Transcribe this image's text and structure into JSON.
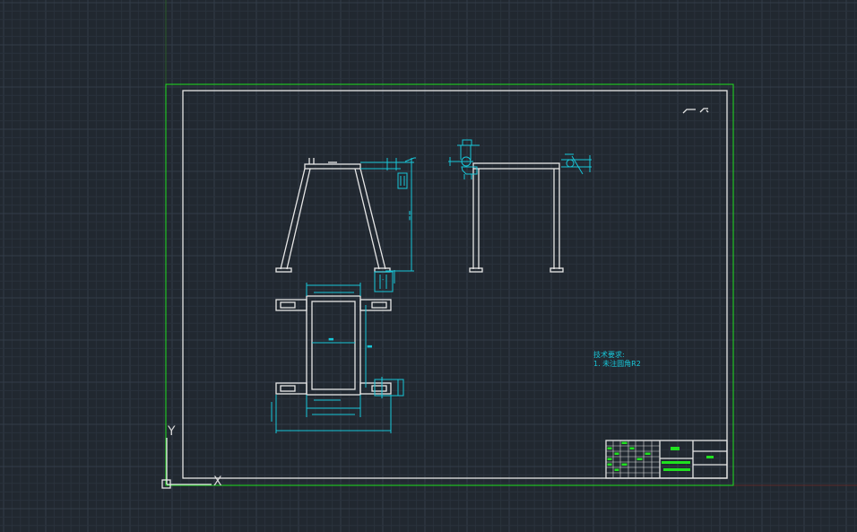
{
  "ucs": {
    "x_label": "X",
    "y_label": "Y"
  },
  "notes": {
    "heading": "技术要求:",
    "line1": "1. 未注圆角R2"
  },
  "colors": {
    "background": "#212830",
    "drawing_lines": "#e6e6e6",
    "dimensions": "#18c6d8",
    "sheet_border": "#20e020",
    "title_block_fill": "#20e020"
  }
}
